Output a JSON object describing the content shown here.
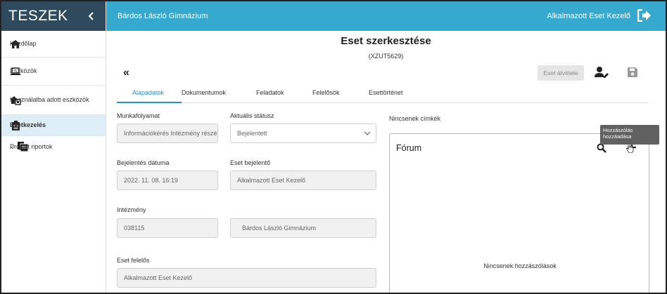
{
  "sidebar": {
    "title": "TESZEK",
    "items": [
      {
        "label": "Kezdőlap",
        "icon": "home-icon"
      },
      {
        "label": "Eszközök",
        "icon": "laptop-icon"
      },
      {
        "label": "Használatba adott eszközök",
        "icon": "home-device-icon"
      },
      {
        "label": "Esetkezelés",
        "icon": "clipboard-icon",
        "active": true
      },
      {
        "label": "Projekt riportok",
        "icon": "report-icon",
        "expandable": true
      }
    ]
  },
  "header": {
    "school": "Bárdos László Gimnázium",
    "user": "Alkalmazott Eset Kezelő"
  },
  "page": {
    "title": "Eset szerkesztése",
    "case_id": "(XZUT5629)",
    "take_button": "Eset átvétele"
  },
  "tabs": [
    "Alapadatok",
    "Dokumentumok",
    "Feladatok",
    "Felelősök",
    "Esettörténet"
  ],
  "form": {
    "workflow_label": "Munkafolyamat",
    "workflow_value": "Információkérés Intézmény részé",
    "status_label": "Aktuális státusz",
    "status_value": "Bejelentett",
    "date_label": "Bejelentés dátuma",
    "date_value": "2022. 11. 08. 16:19",
    "reporter_label": "Eset bejelentő",
    "reporter_value": "Alkalmazott Eset Kezelő",
    "institution_label": "Intézmény",
    "institution_code": "038115",
    "institution_name": "Bárdos László Gimnázium",
    "owner_label": "Eset felelős",
    "owner_value": "Alkalmazott Eset Kezelő"
  },
  "tags": {
    "empty": "Nincsenek címkék"
  },
  "forum": {
    "title": "Fórum",
    "empty": "Nincsenek hozzászólások",
    "tooltip_line1": "Hozzászólás",
    "tooltip_line2": "hozzáadása"
  },
  "colors": {
    "sidebar_header": "#2e4a5c",
    "topbar": "#36a9cf",
    "accent": "#2c8fbf",
    "active_item": "#ddeef6"
  }
}
